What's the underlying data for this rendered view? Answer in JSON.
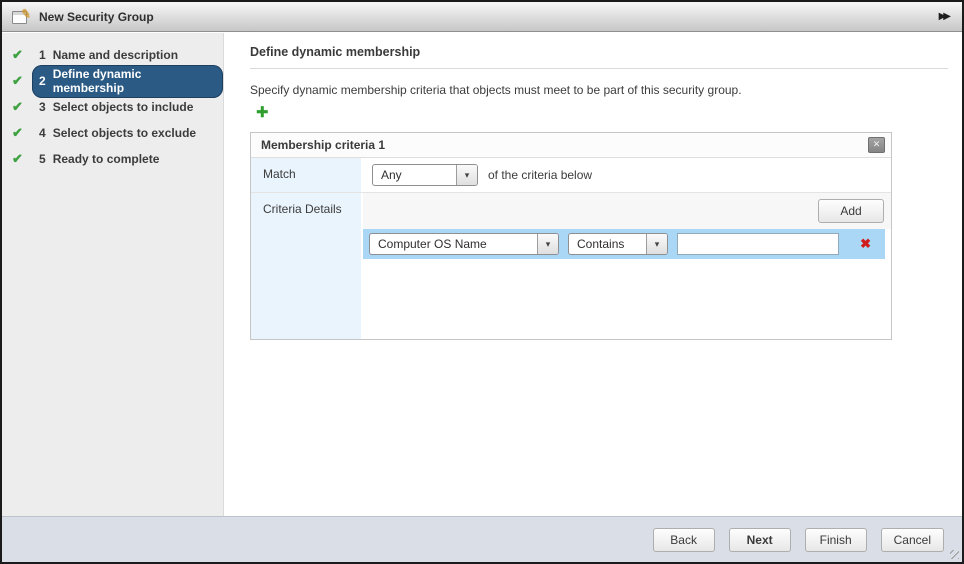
{
  "window": {
    "title": "New Security Group"
  },
  "icons": {
    "edit": "✎",
    "expand": "▶▶",
    "check": "✔",
    "plus": "✚",
    "close": "✕",
    "dropdown_arrow": "▾",
    "delete": "✖"
  },
  "sidebar": {
    "steps": [
      {
        "num": "1",
        "label": "Name and description",
        "completed": true,
        "active": false
      },
      {
        "num": "2",
        "label": "Define dynamic membership",
        "completed": true,
        "active": true
      },
      {
        "num": "3",
        "label": "Select objects to include",
        "completed": true,
        "active": false
      },
      {
        "num": "4",
        "label": "Select objects to exclude",
        "completed": true,
        "active": false
      },
      {
        "num": "5",
        "label": "Ready to complete",
        "completed": true,
        "active": false
      }
    ]
  },
  "main": {
    "heading": "Define dynamic membership",
    "description": "Specify dynamic membership criteria that objects must meet to be part of this security group.",
    "panel": {
      "title": "Membership criteria 1",
      "match_label": "Match",
      "match_value": "Any",
      "match_suffix": "of the criteria below",
      "criteria_label": "Criteria Details",
      "add_button": "Add",
      "criteria_row": {
        "key": "Computer OS Name",
        "operator": "Contains",
        "value": ""
      }
    }
  },
  "footer": {
    "buttons": [
      "Back",
      "Next",
      "Finish",
      "Cancel"
    ]
  },
  "colors": {
    "active_step_bg": "#2b5a85",
    "check_green": "#3fa142",
    "plus_green": "#2f9e2f",
    "row_highlight": "#aad7f5",
    "label_cell_bg": "#e9f4fc",
    "footer_bg": "#d9dee7",
    "delete_red": "#cf1d1d"
  }
}
